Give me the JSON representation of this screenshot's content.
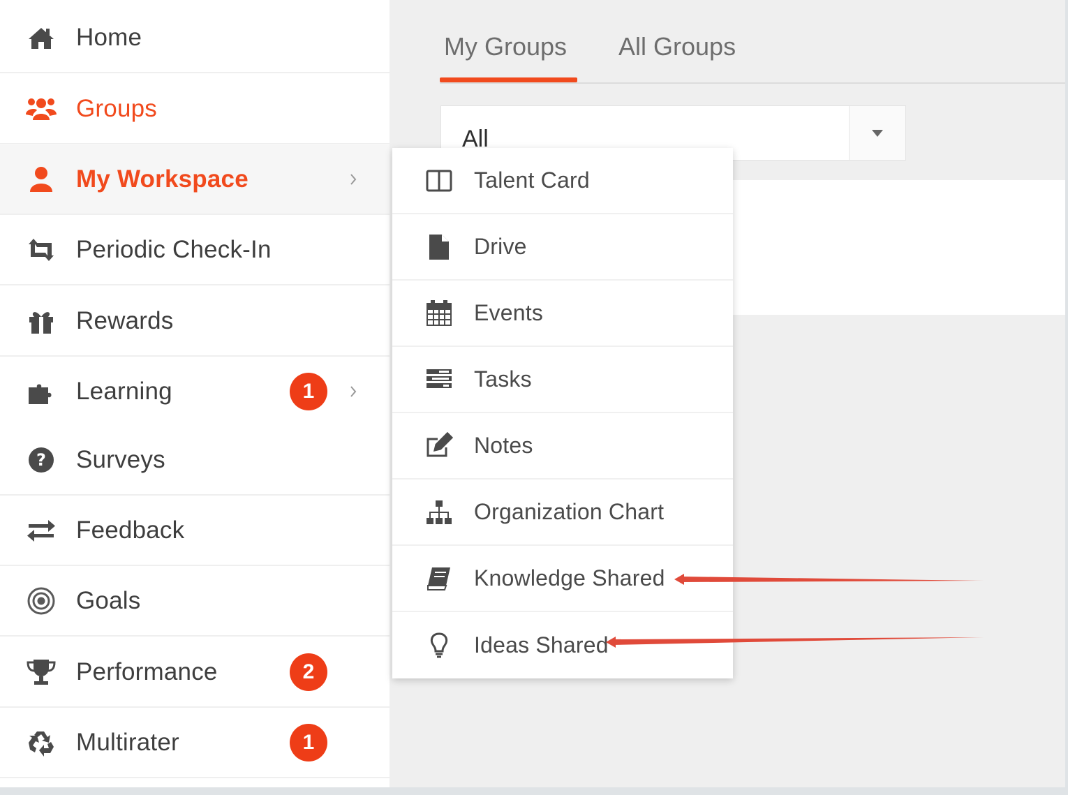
{
  "colors": {
    "accent": "#f14a1d",
    "badge": "#ee3d17",
    "annotation_arrow": "#e04a3a"
  },
  "sidebar": {
    "items": [
      {
        "label": "Home",
        "icon": "home-icon"
      },
      {
        "label": "Groups",
        "icon": "users-icon",
        "active": true
      },
      {
        "label": "My Workspace",
        "icon": "user-icon",
        "active": true,
        "has_submenu": true
      },
      {
        "label": "Periodic Check-In",
        "icon": "retweet-icon"
      },
      {
        "label": "Rewards",
        "icon": "gift-icon"
      },
      {
        "label": "Learning",
        "icon": "puzzle-icon",
        "badge": "1",
        "has_submenu": true
      },
      {
        "label": "Surveys",
        "icon": "question-circle-icon"
      },
      {
        "label": "Feedback",
        "icon": "exchange-icon"
      },
      {
        "label": "Goals",
        "icon": "target-icon"
      },
      {
        "label": "Performance",
        "icon": "trophy-icon",
        "badge": "2"
      },
      {
        "label": "Multirater",
        "icon": "recycle-icon",
        "badge": "1"
      }
    ]
  },
  "tabs": [
    {
      "label": "My Groups",
      "active": true
    },
    {
      "label": "All Groups",
      "active": false
    }
  ],
  "filter": {
    "selected": "All"
  },
  "submenu": {
    "items": [
      {
        "label": "Talent Card",
        "icon": "columns-icon"
      },
      {
        "label": "Drive",
        "icon": "file-icon"
      },
      {
        "label": "Events",
        "icon": "calendar-icon"
      },
      {
        "label": "Tasks",
        "icon": "tasks-icon"
      },
      {
        "label": "Notes",
        "icon": "edit-icon"
      },
      {
        "label": "Organization Chart",
        "icon": "sitemap-icon"
      },
      {
        "label": "Knowledge Shared",
        "icon": "book-icon"
      },
      {
        "label": "Ideas Shared",
        "icon": "lightbulb-icon"
      }
    ]
  }
}
